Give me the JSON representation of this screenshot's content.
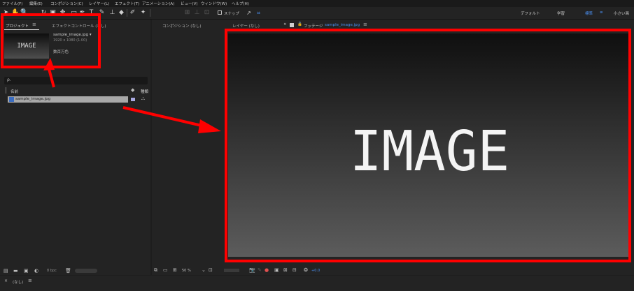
{
  "menu": [
    "ファイル(F)",
    "編集(E)",
    "コンポジション(C)",
    "レイヤー(L)",
    "エフェクト(T)",
    "アニメーション(A)",
    "ビュー(V)",
    "ウィンドウ(W)",
    "ヘルプ(H)"
  ],
  "toolbar": {
    "snap_label": "スナップ",
    "workspaces": [
      "デフォルト",
      "学習",
      "標準",
      "小さい画"
    ],
    "active_workspace": "標準"
  },
  "project": {
    "tab_project": "プロジェクト",
    "tab_effects": "エフェクトコントロール (なし)",
    "thumb_text": "IMAGE",
    "file_name": "sample_image.jpg ▾",
    "file_info": "1920 x 1080 (1.00)",
    "color_label": "数百万色",
    "search_placeholder": "ρ.",
    "col_name": "名前",
    "col_type": "種類",
    "item_name": "sample_image.jpg",
    "bpc": "8 bpc"
  },
  "viewer": {
    "tab_composition": "コンポジション (なし)",
    "tab_layer": "レイヤー (なし)",
    "tab_footage_prefix": "フッテージ",
    "tab_footage_file": "sample_image.jpg",
    "image_text": "IMAGE",
    "zoom": "50 %",
    "offset": "+0.0"
  },
  "timeline": {
    "label": "(なし)"
  },
  "colors": {
    "accent": "#4a8ff0",
    "annotation": "#ff0000"
  }
}
